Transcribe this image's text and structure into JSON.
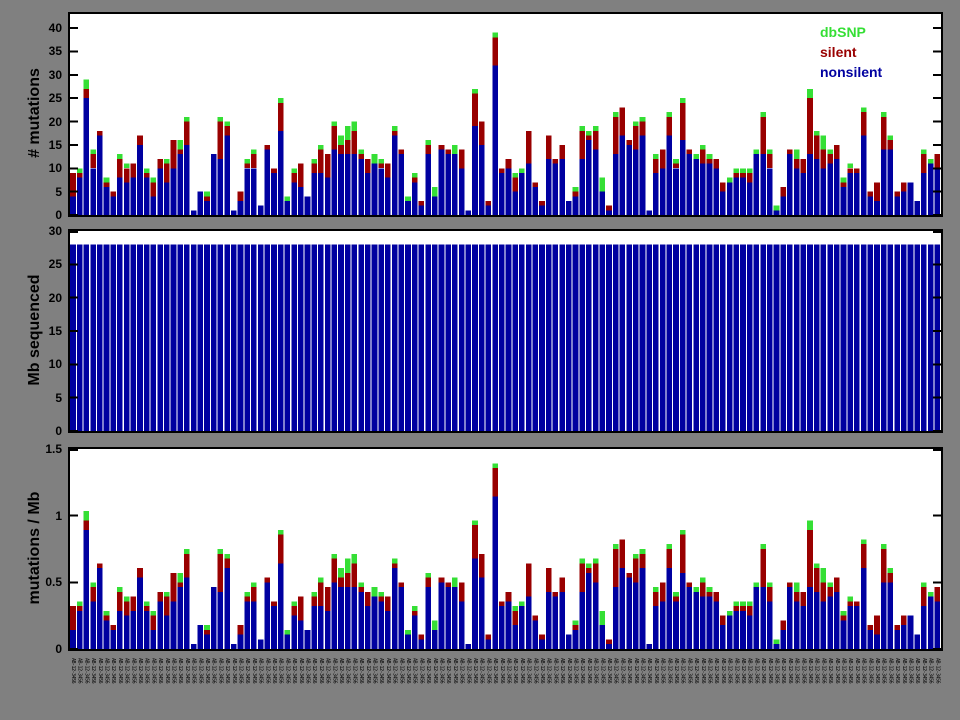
{
  "figure": {
    "background_color": "#808080",
    "plot_background_color": "#ffffff",
    "axis_color": "#000000"
  },
  "legend": {
    "position": "top-right-inside-first-panel",
    "items": [
      {
        "label": "dbSNP",
        "color": "#35DF35"
      },
      {
        "label": "silent",
        "color": "#990000"
      },
      {
        "label": "nonsilent",
        "color": "#0000A0"
      }
    ]
  },
  "panels": [
    {
      "ylabel": "# mutations",
      "ytick_labels": [
        "0",
        "5",
        "10",
        "15",
        "20",
        "25",
        "30",
        "35",
        "40"
      ],
      "ytick_values": [
        0,
        5,
        10,
        15,
        20,
        25,
        30,
        35,
        40
      ],
      "ylim": [
        0,
        43
      ]
    },
    {
      "ylabel": "Mb sequenced",
      "ytick_labels": [
        "0",
        "5",
        "10",
        "15",
        "20",
        "25",
        "30"
      ],
      "ytick_values": [
        0,
        5,
        10,
        15,
        20,
        25,
        30
      ],
      "ylim": [
        0,
        30
      ]
    },
    {
      "ylabel": "mutations / Mb",
      "ytick_labels": [
        "0",
        "0.5",
        "1",
        "1.5"
      ],
      "ytick_values": [
        0,
        0.5,
        1,
        1.5
      ],
      "ylim": [
        0,
        1.5
      ]
    }
  ],
  "x_axis": {
    "n_samples": 130,
    "labels_legible": false,
    "label_placeholder": "AB-12-3456"
  },
  "chart_data": [
    {
      "type": "bar",
      "stacked": true,
      "ylabel": "# mutations",
      "ylim": [
        0,
        43
      ],
      "grid": false,
      "legend_position": "top-right",
      "n_bars": 130,
      "x_tick_labels": "130 rotated sample identifiers, illegible at this resolution",
      "series": [
        {
          "name": "nonsilent",
          "color": "#0000A0",
          "values": [
            4,
            8,
            25,
            10,
            17,
            6,
            4,
            8,
            7,
            8,
            15,
            8,
            4,
            10,
            7,
            10,
            13,
            15,
            1,
            5,
            3,
            13,
            12,
            17,
            1,
            3,
            10,
            10,
            2,
            14,
            9,
            18,
            3,
            7,
            6,
            4,
            9,
            9,
            8,
            14,
            13,
            13,
            13,
            12,
            9,
            11,
            10,
            8,
            17,
            13,
            3,
            7,
            2,
            13,
            4,
            14,
            13,
            13,
            10,
            1,
            19,
            15,
            2,
            32,
            9,
            10,
            5,
            9,
            11,
            6,
            2,
            12,
            11,
            12,
            3,
            4,
            12,
            16,
            14,
            5,
            1,
            13,
            17,
            15,
            14,
            17,
            1,
            9,
            10,
            17,
            10,
            16,
            13,
            12,
            11,
            11,
            10,
            5,
            7,
            8,
            8,
            7,
            13,
            13,
            10,
            1,
            4,
            13,
            10,
            9,
            13,
            12,
            10,
            11,
            12,
            6,
            9,
            9,
            17,
            4,
            3,
            14,
            14,
            4,
            5,
            7,
            3,
            9,
            11,
            10
          ]
        },
        {
          "name": "silent",
          "color": "#990000",
          "values": [
            5,
            1,
            2,
            3,
            1,
            1,
            1,
            4,
            3,
            3,
            2,
            1,
            3,
            2,
            4,
            6,
            1,
            5,
            0,
            0,
            1,
            0,
            8,
            2,
            0,
            2,
            1,
            3,
            0,
            1,
            1,
            6,
            0,
            2,
            5,
            0,
            2,
            5,
            5,
            5,
            2,
            3,
            5,
            1,
            3,
            0,
            1,
            3,
            1,
            1,
            0,
            1,
            1,
            2,
            0,
            1,
            1,
            0,
            4,
            0,
            7,
            5,
            1,
            6,
            1,
            2,
            3,
            0,
            7,
            1,
            1,
            5,
            1,
            3,
            0,
            1,
            6,
            1,
            4,
            0,
            1,
            8,
            6,
            1,
            5,
            3,
            0,
            3,
            4,
            4,
            1,
            8,
            1,
            0,
            3,
            1,
            2,
            2,
            0,
            1,
            1,
            2,
            0,
            8,
            3,
            0,
            2,
            1,
            2,
            3,
            12,
            5,
            4,
            2,
            3,
            1,
            1,
            1,
            5,
            1,
            4,
            7,
            2,
            1,
            2,
            0,
            0,
            4,
            0,
            3
          ]
        },
        {
          "name": "dbSNP",
          "color": "#35DF35",
          "values": [
            0,
            1,
            2,
            1,
            0,
            1,
            0,
            1,
            1,
            0,
            0,
            1,
            1,
            0,
            1,
            0,
            2,
            1,
            0,
            0,
            1,
            0,
            1,
            1,
            0,
            0,
            1,
            1,
            0,
            0,
            0,
            1,
            1,
            1,
            0,
            0,
            1,
            1,
            0,
            1,
            2,
            3,
            2,
            1,
            0,
            2,
            1,
            0,
            1,
            0,
            1,
            1,
            0,
            1,
            2,
            0,
            0,
            2,
            0,
            0,
            1,
            0,
            0,
            1,
            0,
            0,
            1,
            1,
            0,
            0,
            0,
            0,
            0,
            0,
            0,
            1,
            1,
            1,
            1,
            3,
            0,
            1,
            0,
            0,
            1,
            1,
            0,
            1,
            0,
            1,
            1,
            1,
            0,
            1,
            1,
            1,
            0,
            0,
            1,
            1,
            1,
            1,
            1,
            1,
            1,
            1,
            0,
            0,
            2,
            0,
            2,
            1,
            3,
            1,
            0,
            1,
            1,
            0,
            1,
            0,
            0,
            1,
            1,
            0,
            0,
            0,
            0,
            1,
            1,
            0
          ]
        }
      ]
    },
    {
      "type": "bar",
      "stacked": false,
      "ylabel": "Mb sequenced",
      "ylim": [
        0,
        30
      ],
      "grid": false,
      "n_bars": 130,
      "uniform_value": 28,
      "color": "#0000A0",
      "note": "all 130 samples have ~28 Mb sequenced"
    },
    {
      "type": "bar",
      "stacked": true,
      "ylabel": "mutations / Mb",
      "ylim": [
        0,
        1.5
      ],
      "grid": false,
      "n_bars": 130,
      "derived_from": "panel 1 mutation counts divided by Mb sequenced (28 Mb per sample), same nonsilent/silent/dbSNP composition",
      "max_value": 1.39
    }
  ]
}
